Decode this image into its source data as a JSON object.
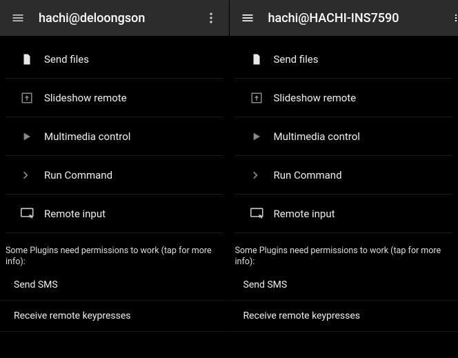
{
  "panes": [
    {
      "title": "hachi@deloongson",
      "items": [
        {
          "icon": "file",
          "label": "Send files"
        },
        {
          "icon": "upload-box",
          "label": "Slideshow remote"
        },
        {
          "icon": "play",
          "label": "Multimedia control"
        },
        {
          "icon": "chevron-right",
          "label": "Run Command"
        },
        {
          "icon": "remote-input",
          "label": "Remote input"
        }
      ],
      "perm_header": "Some Plugins need permissions to work (tap for more info):",
      "perms": [
        "Send SMS",
        "Receive remote keypresses"
      ]
    },
    {
      "title": "hachi@HACHI-INS7590",
      "items": [
        {
          "icon": "file",
          "label": "Send files"
        },
        {
          "icon": "upload-box",
          "label": "Slideshow remote"
        },
        {
          "icon": "play",
          "label": "Multimedia control"
        },
        {
          "icon": "chevron-right",
          "label": "Run Command"
        },
        {
          "icon": "remote-input",
          "label": "Remote input"
        }
      ],
      "perm_header": "Some Plugins need permissions to work (tap for more info):",
      "perms": [
        "Send SMS",
        "Receive remote keypresses"
      ]
    }
  ]
}
